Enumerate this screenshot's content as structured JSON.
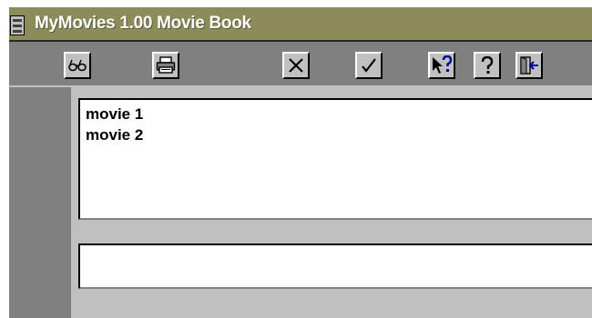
{
  "window": {
    "title": "MyMovies 1.00 Movie Book",
    "icon": "application-icon"
  },
  "toolbar": {
    "buttons": [
      {
        "name": "find",
        "icon": "glasses-icon"
      },
      {
        "name": "print",
        "icon": "printer-icon"
      },
      {
        "name": "delete",
        "icon": "x-icon"
      },
      {
        "name": "ok",
        "icon": "checkmark-icon"
      },
      {
        "name": "context-help",
        "icon": "arrow-question-icon"
      },
      {
        "name": "help",
        "icon": "question-icon"
      },
      {
        "name": "exit",
        "icon": "exit-door-icon"
      }
    ]
  },
  "movie_list": {
    "items": [
      "movie 1",
      "movie 2"
    ]
  },
  "entry": {
    "value": "",
    "placeholder": ""
  },
  "colors": {
    "title_bar": "#8c8c5a",
    "face": "#c0c0c0",
    "frame": "#808080"
  }
}
